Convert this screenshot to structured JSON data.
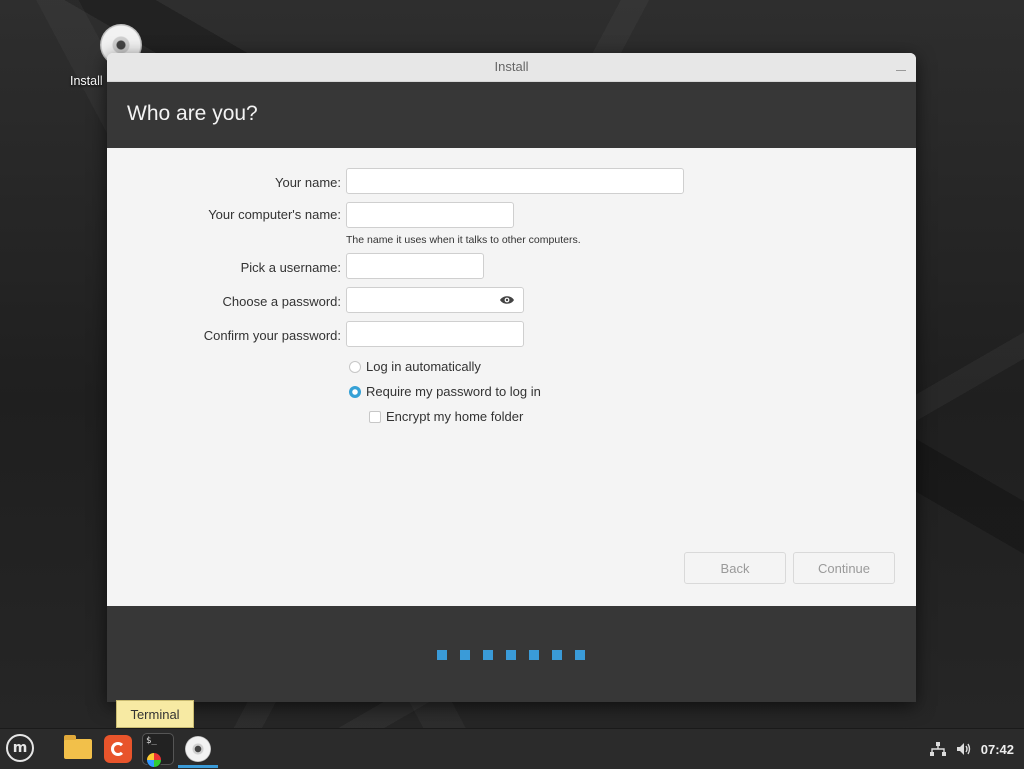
{
  "desktop": {
    "install_icon_label": "Install"
  },
  "window": {
    "title": "Install",
    "heading": "Who are you?"
  },
  "form": {
    "your_name_label": "Your name:",
    "your_name_value": "",
    "computer_name_label": "Your computer's name:",
    "computer_name_value": "",
    "computer_name_hint": "The name it uses when it talks to other computers.",
    "username_label": "Pick a username:",
    "username_value": "",
    "password_label": "Choose a password:",
    "password_value": "",
    "confirm_password_label": "Confirm your password:",
    "confirm_password_value": "",
    "login_auto_label": "Log in automatically",
    "login_auto_selected": false,
    "require_password_label": "Require my password to log in",
    "require_password_selected": true,
    "encrypt_home_label": "Encrypt my home folder",
    "encrypt_home_checked": false
  },
  "buttons": {
    "back_label": "Back",
    "continue_label": "Continue"
  },
  "progress": {
    "step_count": 7
  },
  "tooltip": {
    "text": "Terminal"
  },
  "panel": {
    "apps": [
      "files",
      "firefox",
      "terminal",
      "install"
    ],
    "clock": "07:42"
  },
  "colors": {
    "accent": "#3a9bd8",
    "header_bg": "#373737",
    "tooltip_bg": "#f7eaa3"
  }
}
